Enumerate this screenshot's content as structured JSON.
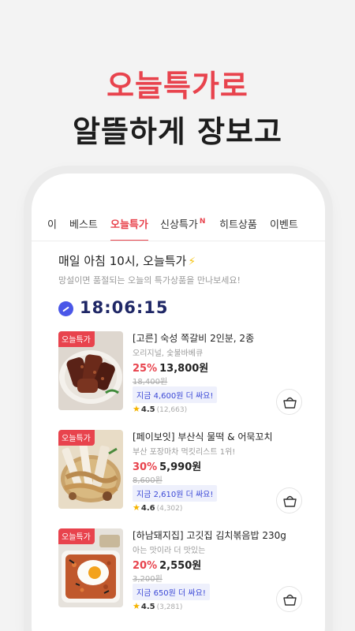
{
  "promo": {
    "headline1": "오늘특가로",
    "headline2": "알뜰하게 장보고"
  },
  "tabs": [
    {
      "label": "이",
      "active": false
    },
    {
      "label": "베스트",
      "active": false
    },
    {
      "label": "오늘특가",
      "active": true
    },
    {
      "label": "신상특가",
      "active": false,
      "badge": "N"
    },
    {
      "label": "히트상품",
      "active": false
    },
    {
      "label": "이벤트",
      "active": false
    }
  ],
  "section": {
    "title": "매일 아침 10시, 오늘특가",
    "title_icon": "⚡",
    "subtitle": "망설이면 품절되는 오늘의 특가상품을 만나보세요!",
    "timer": "18:06:15"
  },
  "products": [
    {
      "badge": "오늘특가",
      "name": "[고른] 숙성 쪽갈비 2인분, 2종",
      "desc": "오리지널, 숯불바베큐",
      "discount": "25%",
      "price": "13,800원",
      "original_price": "18,400원",
      "saving": "지금 4,600원 더 싸요!",
      "rating": "4.5",
      "review_count": "(12,663)",
      "image": "grilled-ribs"
    },
    {
      "badge": "오늘특가",
      "name": "[페이보잇] 부산식 물떡 & 어묵꼬치",
      "desc": "부산 포장마차 먹킷리스트 1위!",
      "discount": "30%",
      "price": "5,990원",
      "original_price": "8,600원",
      "saving": "지금 2,610원 더 싸요!",
      "rating": "4.6",
      "review_count": "(4,302)",
      "image": "rice-cake-fishcake-skewers"
    },
    {
      "badge": "오늘특가",
      "name": "[하남돼지집] 고깃집 김치볶음밥 230g",
      "desc": "아는 맛이라 더 맛있는",
      "discount": "20%",
      "price": "2,550원",
      "original_price": "3,200원",
      "saving": "지금 650원 더 싸요!",
      "rating": "4.5",
      "review_count": "(3,281)",
      "image": "kimchi-fried-rice"
    }
  ],
  "icons": {
    "timer": "clock-icon",
    "cart": "shopping-basket-icon",
    "rating": "star-icon"
  },
  "colors": {
    "accent": "#e8434d",
    "timer_text": "#1f2766",
    "clock": "#4a57e8",
    "saving_text": "#3b48d6"
  }
}
